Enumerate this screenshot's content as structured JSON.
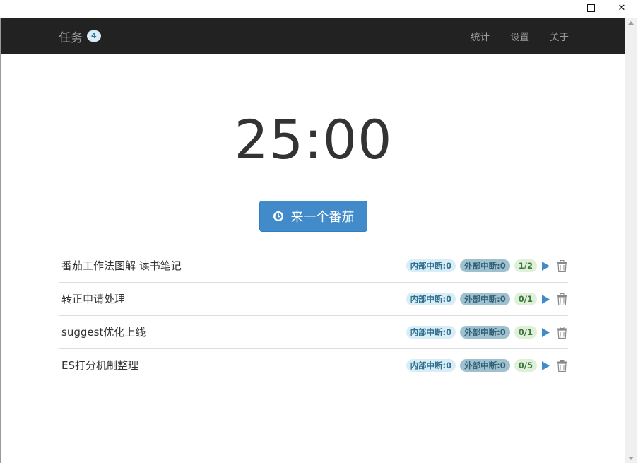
{
  "window": {
    "minimize_icon": "minimize-icon",
    "maximize_icon": "maximize-icon",
    "close_label": "✕"
  },
  "navbar": {
    "brand": "任务",
    "brand_count": "4",
    "links": [
      "统计",
      "设置",
      "关于"
    ]
  },
  "timer": {
    "display": "25:00"
  },
  "start_button": {
    "label": "来一个番茄",
    "icon": "clock-icon"
  },
  "tasks": [
    {
      "title": "番茄工作法图解 读书笔记",
      "internal": "内部中断:0",
      "external": "外部中断:0",
      "progress": "1/2"
    },
    {
      "title": "转正申请处理",
      "internal": "内部中断:0",
      "external": "外部中断:0",
      "progress": "0/1"
    },
    {
      "title": "suggest优化上线",
      "internal": "内部中断:0",
      "external": "外部中断:0",
      "progress": "0/1"
    },
    {
      "title": "ES打分机制整理",
      "internal": "内部中断:0",
      "external": "外部中断:0",
      "progress": "0/5"
    }
  ],
  "colors": {
    "navbar_bg": "#222222",
    "primary": "#428bca",
    "play": "#428bca",
    "delete": "#888888"
  }
}
